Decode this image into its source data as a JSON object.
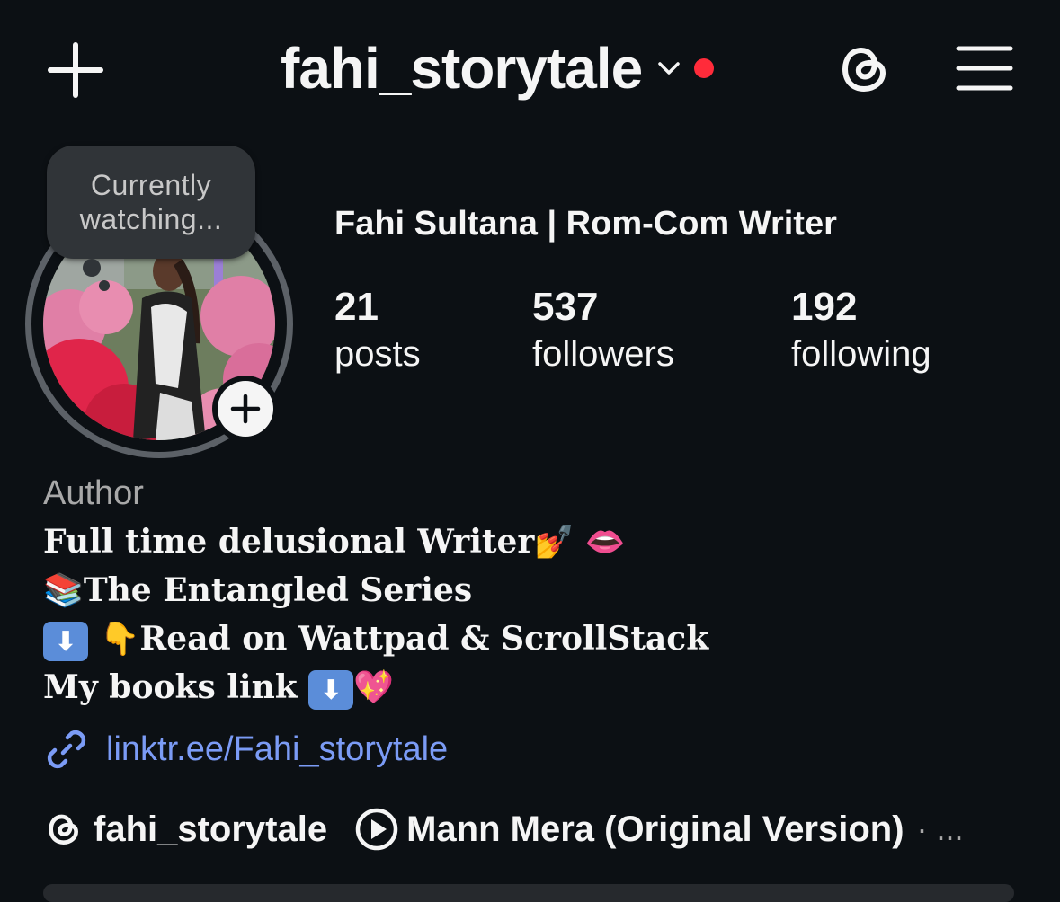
{
  "header": {
    "username": "fahi_storytale",
    "has_new_dot": true,
    "accent_dot_color": "#ff2b3a"
  },
  "icons": {
    "create": "plus-icon",
    "switch_account": "chevron-down-icon",
    "threads": "threads-icon",
    "menu": "hamburger-menu-icon",
    "link": "link-icon",
    "music": "play-circle-icon"
  },
  "note": {
    "line1": "Currently",
    "line2": "watching..."
  },
  "profile": {
    "display_name": "Fahi Sultana | Rom-Com Writer",
    "category": "Author",
    "stats": [
      {
        "value": "21",
        "label": "posts"
      },
      {
        "value": "537",
        "label": "followers"
      },
      {
        "value": "192",
        "label": "following"
      }
    ]
  },
  "bio": {
    "line1_text": "Full time delusional Writer",
    "line1_emoji": "💅 👄",
    "line2_emoji": "📚",
    "line2_text": "The Entangled Series",
    "line3_emoji1": "⬇",
    "line3_emoji2": "👇",
    "line3_text": "Read on Wattpad & ScrollStack",
    "line4_text": "My books link ",
    "line4_emoji1": "⬇",
    "line4_emoji2": "💖",
    "link": "linktr.ee/Fahi_storytale"
  },
  "footer": {
    "threads_username": "fahi_storytale",
    "music_title": "Mann Mera (Original Version)",
    "more": "· ..."
  },
  "colors": {
    "background": "#0c1014",
    "link": "#7b9bf5",
    "secondary_text": "#a8a8a8"
  }
}
